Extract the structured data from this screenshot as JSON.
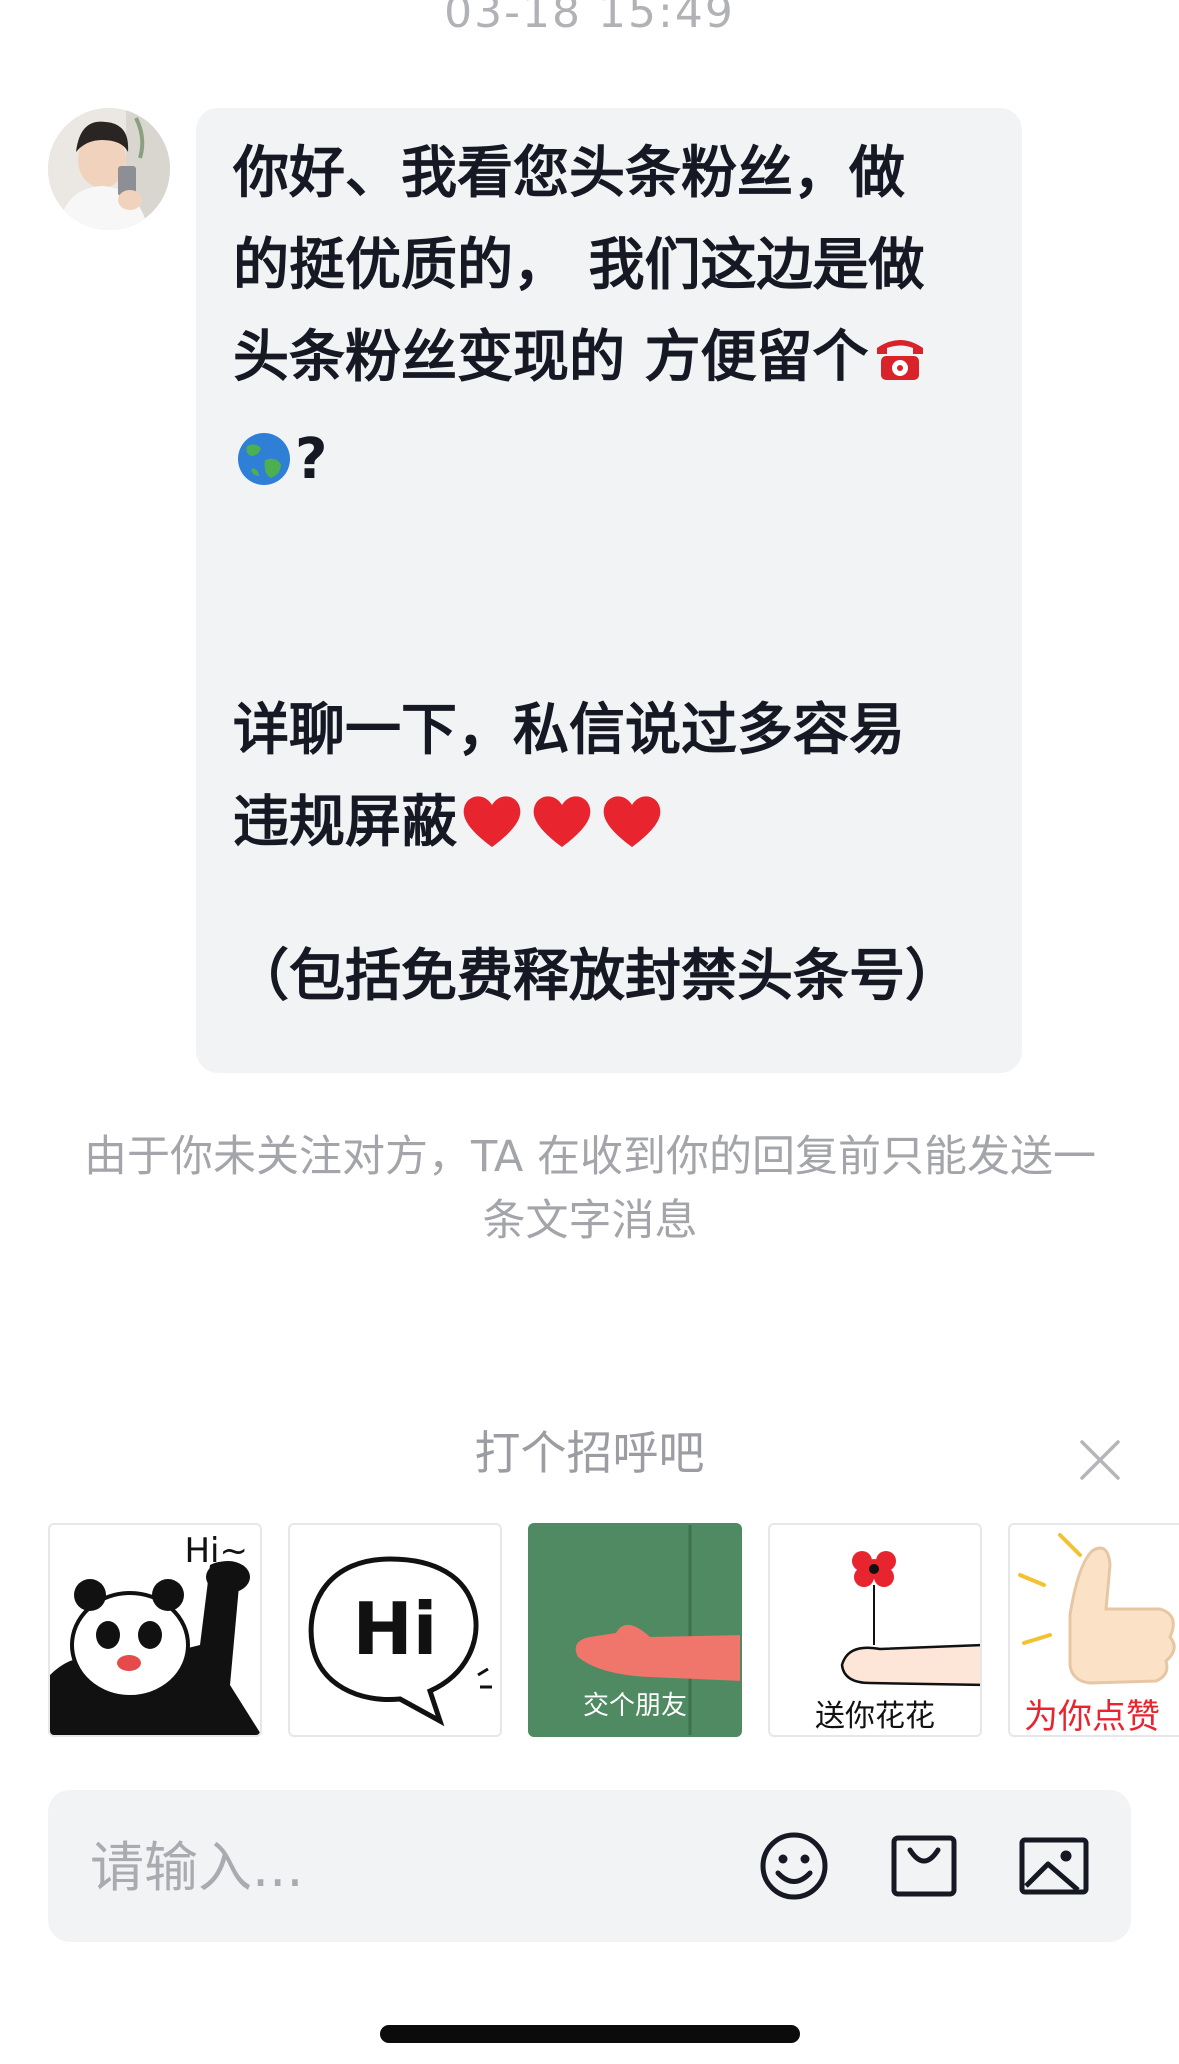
{
  "chat": {
    "timestamp": "03-18 15:49",
    "message": {
      "line1": "你好、我看您头条粉丝，做",
      "line2": "的挺优质的， 我们这边是做",
      "line3": "头条粉丝变现的 方便留个",
      "line4_suffix": "?",
      "line5": "详聊一下，私信说过多容易",
      "line6": "违规屏蔽",
      "line7": "（包括免费释放封禁头条号）"
    },
    "notice": "由于你未关注对方，TA 在收到你的回复前只能发送一条文字消息"
  },
  "greeting": {
    "title": "打个招呼吧",
    "stickers": [
      {
        "text": "Hi~"
      },
      {
        "text": "Hi"
      },
      {
        "text": "交个朋友"
      },
      {
        "text": "送你花花"
      },
      {
        "text": "为你点赞"
      }
    ]
  },
  "input": {
    "placeholder": "请输入..."
  },
  "icons": {
    "avatar": "avatar",
    "phone": "telephone-emoji-icon",
    "globe": "globe-emoji-icon",
    "heart": "red-heart-emoji-icon",
    "close": "close-icon",
    "emoji": "emoji-icon",
    "bag": "shopping-bag-icon",
    "image": "image-icon"
  },
  "colors": {
    "bubble": "#f2f3f5",
    "text": "#161823",
    "secondary": "#a3a5aa",
    "heart": "#e8242f"
  }
}
